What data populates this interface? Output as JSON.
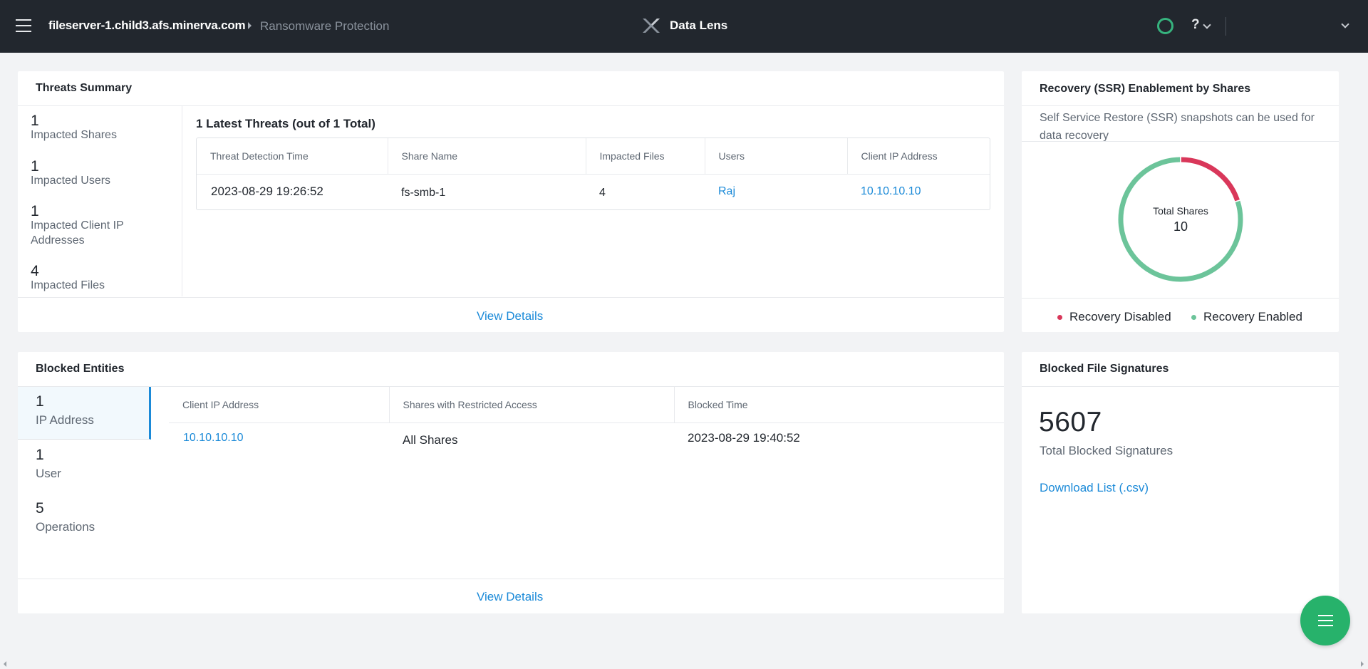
{
  "header": {
    "server_name": "fileserver-1.child3.afs.minerva.com",
    "section": "Ransomware Protection",
    "app_name": "Data Lens",
    "help_label": "?"
  },
  "threats_summary": {
    "title": "Threats Summary",
    "stats": [
      {
        "value": "1",
        "label": "Impacted Shares"
      },
      {
        "value": "1",
        "label": "Impacted Users"
      },
      {
        "value": "1",
        "label": "Impacted Client IP Addresses"
      },
      {
        "value": "4",
        "label": "Impacted Files"
      }
    ],
    "latest_title": "1 Latest Threats (out of 1 Total)",
    "columns": [
      "Threat Detection Time",
      "Share Name",
      "Impacted Files",
      "Users",
      "Client IP Address"
    ],
    "rows": [
      {
        "time": "2023-08-29 19:26:52",
        "share": "fs-smb-1",
        "files": "4",
        "user": "Raj",
        "ip": "10.10.10.10"
      }
    ],
    "view_details": "View Details"
  },
  "recovery": {
    "title": "Recovery (SSR) Enablement by Shares",
    "description": "Self Service Restore (SSR) snapshots can be used for data recovery",
    "center_label": "Total Shares",
    "center_value": "10",
    "legend": [
      {
        "label": "Recovery Disabled",
        "color": "#d9375a"
      },
      {
        "label": "Recovery Enabled",
        "color": "#6cc49a"
      }
    ],
    "slices": [
      {
        "name": "Recovery Disabled",
        "value": 2,
        "color": "#d9375a"
      },
      {
        "name": "Recovery Enabled",
        "value": 8,
        "color": "#6cc49a"
      }
    ]
  },
  "blocked_entities": {
    "title": "Blocked Entities",
    "tabs": [
      {
        "value": "1",
        "label": "IP Address",
        "active": true
      },
      {
        "value": "1",
        "label": "User",
        "active": false
      },
      {
        "value": "5",
        "label": "Operations",
        "active": false
      }
    ],
    "columns": [
      "Client IP Address",
      "Shares with Restricted Access",
      "Blocked Time"
    ],
    "rows": [
      {
        "ip": "10.10.10.10",
        "shares": "All Shares",
        "time": "2023-08-29 19:40:52"
      }
    ],
    "view_details": "View Details"
  },
  "blocked_signatures": {
    "title": "Blocked File Signatures",
    "count": "5607",
    "count_label": "Total Blocked Signatures",
    "download_label": "Download List (.csv)"
  },
  "colors": {
    "topbar": "#22272e",
    "link": "#1b8ad8",
    "fab": "#27b26b",
    "status_ok": "#36b37e"
  }
}
